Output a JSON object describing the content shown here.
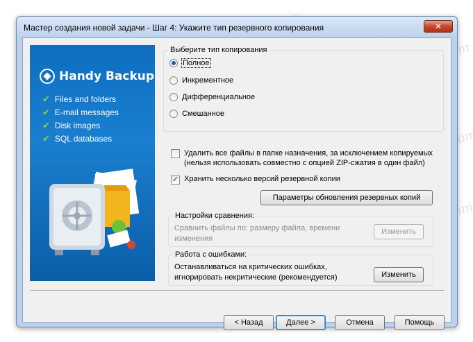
{
  "window": {
    "title": "Мастер создания новой задачи - Шаг 4: Укажите тип резервного копирования",
    "close_glyph": "✕"
  },
  "banner": {
    "brand_name": "Handy Backup",
    "features": [
      "Files and folders",
      "E-mail messages",
      "Disk images",
      "SQL databases"
    ],
    "check_glyph": "✔"
  },
  "copy_type": {
    "legend": "Выберите тип копирования",
    "options": [
      {
        "label": "Полное",
        "selected": true
      },
      {
        "label": "Инкрементное",
        "selected": false
      },
      {
        "label": "Дифференциальное",
        "selected": false
      },
      {
        "label": "Смешанное",
        "selected": false
      }
    ]
  },
  "options": {
    "delete_files_line1": "Удалить все файлы в папке назначения, за исключением копируемых",
    "delete_files_line2": "(нельзя использовать совместно с опцией ZIP-сжатия в один файл)",
    "delete_files_checked": false,
    "keep_versions_label": "Хранить несколько версий резервной копии",
    "keep_versions_checked": true,
    "check_mark": "✓",
    "update_params_button": "Параметры обновления резервных копий"
  },
  "compare": {
    "legend": "Настройки сравнения:",
    "text_line1": "Сравнить файлы по: размеру файла, времени",
    "text_line2": "изменения",
    "change_button": "Изменить"
  },
  "errors": {
    "legend": "Работа с ошибками:",
    "text_line1": "Останавливаться на критических ошибках,",
    "text_line2": "игнорировать некритические (рекомендуется)",
    "change_button": "Изменить"
  },
  "footer": {
    "back": "< Назад",
    "next": "Далее >",
    "cancel": "Отмена",
    "help": "Помощь"
  },
  "watermark": "Soringpcrepair.com",
  "colors": {
    "banner_blue": "#0e6ec0",
    "accent_check": "#8ed23a",
    "close_red": "#c7462e"
  }
}
